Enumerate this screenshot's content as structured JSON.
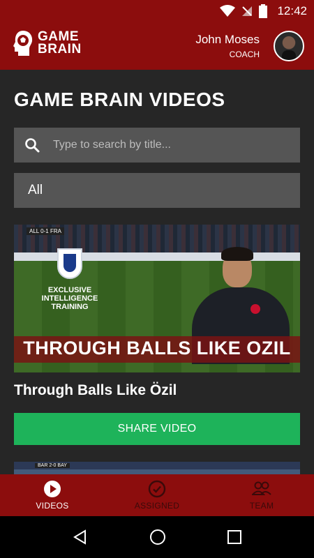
{
  "status": {
    "time": "12:42"
  },
  "header": {
    "logo_line1": "GAME",
    "logo_line2": "BRAIN",
    "user_name": "John Moses",
    "user_role": "COACH"
  },
  "page": {
    "title": "GAME BRAIN VIDEOS"
  },
  "search": {
    "placeholder": "Type to search by title...",
    "value": ""
  },
  "filter": {
    "selected": "All"
  },
  "videos": [
    {
      "thumb_overlay": "THROUGH BALLS LIKE OZIL",
      "thumb_sub": "EXCLUSIVE INTELLIGENCE TRAINING",
      "thumb_score": "ALL 0-1 FRA",
      "title": "Through Balls Like Özil",
      "share_label": "SHARE VIDEO"
    },
    {
      "thumb_score": "BAR 2-0 BAY"
    }
  ],
  "tabs": [
    {
      "label": "VIDEOS",
      "icon": "play-circle-icon",
      "active": true
    },
    {
      "label": "ASSIGNED",
      "icon": "check-circle-icon",
      "active": false
    },
    {
      "label": "TEAM",
      "icon": "team-icon",
      "active": false
    }
  ],
  "colors": {
    "brand": "#8c0d0d",
    "background": "#262626",
    "field": "#555555",
    "share": "#1eb35a"
  }
}
